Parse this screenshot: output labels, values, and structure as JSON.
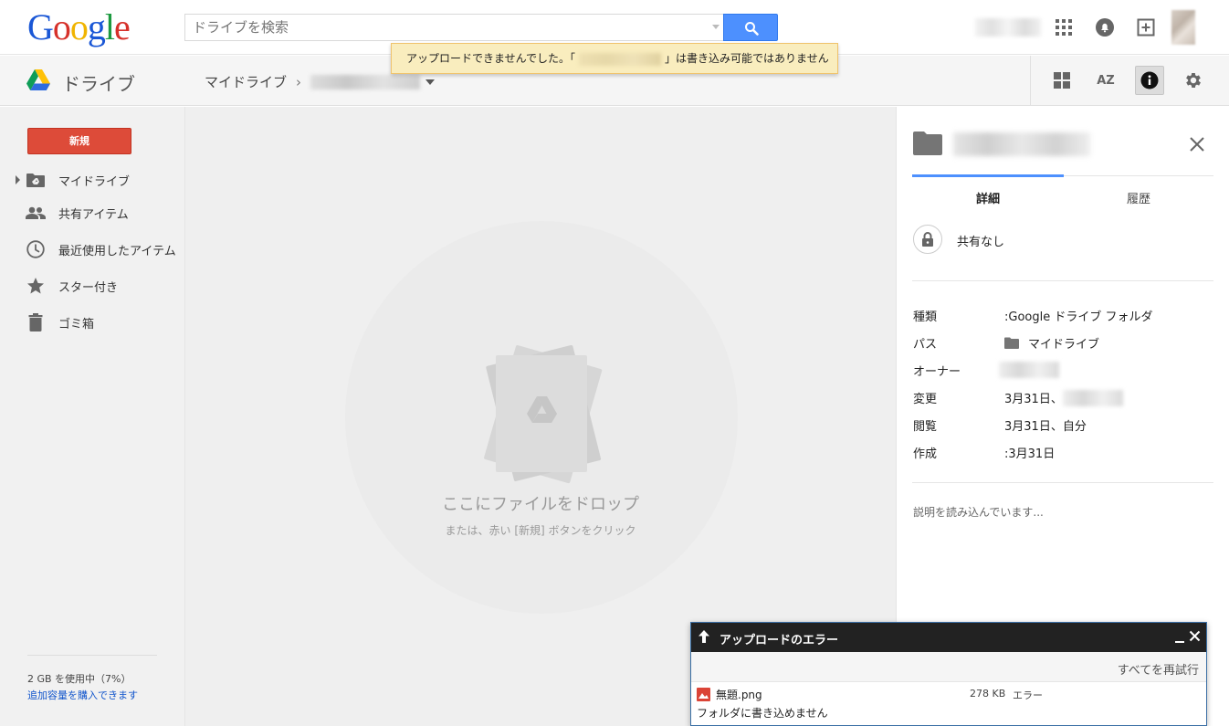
{
  "header": {
    "logo_letters": [
      {
        "char": "G",
        "color": "#1a57d6"
      },
      {
        "char": "o",
        "color": "#d6312a"
      },
      {
        "char": "o",
        "color": "#f0b400"
      },
      {
        "char": "g",
        "color": "#1a57d6"
      },
      {
        "char": "l",
        "color": "#1c9a3f"
      },
      {
        "char": "e",
        "color": "#d6312a"
      }
    ],
    "search_placeholder": "ドライブを検索"
  },
  "toast": {
    "prefix": "アップロードできませんでした。「",
    "suffix": "」は書き込み可能ではありません"
  },
  "toolbar": {
    "app_title": "ドライブ",
    "breadcrumb_root": "マイドライブ",
    "breadcrumb_sep": "›",
    "sort_label": "AZ"
  },
  "sidebar": {
    "new_button": "新規",
    "items": [
      {
        "label": "マイドライブ",
        "icon": "drive-folder-icon"
      },
      {
        "label": "共有アイテム",
        "icon": "people-icon"
      },
      {
        "label": "最近使用したアイテム",
        "icon": "clock-icon"
      },
      {
        "label": "スター付き",
        "icon": "star-icon"
      },
      {
        "label": "ゴミ箱",
        "icon": "trash-icon"
      }
    ],
    "storage_text": "2 GB を使用中（7%）",
    "buy_storage": "追加容量を購入できます"
  },
  "main": {
    "drop_title": "ここにファイルをドロップ",
    "drop_sub": "または、赤い [新規] ボタンをクリック"
  },
  "details": {
    "tabs": {
      "details": "詳細",
      "activity": "履歴"
    },
    "sharing": "共有なし",
    "properties": {
      "type_label": "種類",
      "type_value": ":Google ドライブ フォルダ",
      "path_label": "パス",
      "path_value": "マイドライブ",
      "owner_label": "オーナー",
      "modified_label": "変更",
      "modified_value": "3月31日、",
      "viewed_label": "閲覧",
      "viewed_value": "3月31日、自分",
      "created_label": "作成",
      "created_value": ":3月31日"
    },
    "description_loading": "説明を読み込んでいます..."
  },
  "upload_dialog": {
    "title": "アップロードのエラー",
    "minimize": "_",
    "retry_all": "すべてを再試行",
    "file": {
      "name": "無題.png",
      "size": "278 KB",
      "status": "エラー",
      "error": "フォルダに書き込めません"
    }
  },
  "colors": {
    "accent_blue": "#4d90fe",
    "new_button_red": "#dd4b39",
    "toast_bg": "#f9edbe"
  }
}
